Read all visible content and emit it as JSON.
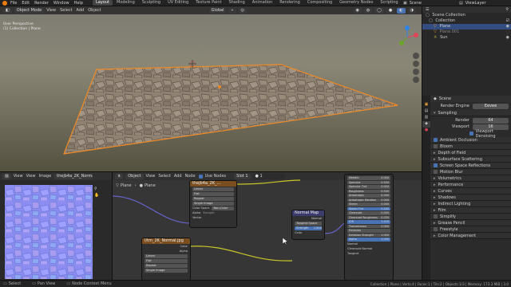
{
  "topbar": {
    "menus": [
      "File",
      "Edit",
      "Render",
      "Window",
      "Help"
    ],
    "workspaces": [
      "Layout",
      "Modeling",
      "Sculpting",
      "UV Editing",
      "Texture Paint",
      "Shading",
      "Animation",
      "Rendering",
      "Compositing",
      "Geometry Nodes",
      "Scripting"
    ],
    "active_workspace": "Layout",
    "scene": "Scene",
    "view_layer": "ViewLayer"
  },
  "viewport": {
    "mode": "Object Mode",
    "menus": [
      "View",
      "Select",
      "Add",
      "Object"
    ],
    "orientation": "Global",
    "info_line1": "User Perspective",
    "info_line2": "(1) Collection | Plane"
  },
  "outliner": {
    "root": "Scene Collection",
    "collection": "Collection",
    "items": [
      "Plane",
      "Plane.001",
      "Sun"
    ]
  },
  "properties": {
    "title": "Scene",
    "render_engine_label": "Render Engine",
    "render_engine": "Eevee",
    "sampling": "Sampling",
    "render_label": "Render",
    "render_value": "64",
    "viewport_label": "Viewport",
    "viewport_value": "16",
    "viewport_denoising": "Viewport Denoising",
    "panels": [
      "Ambient Occlusion",
      "Bloom",
      "Depth of Field",
      "Subsurface Scattering",
      "Screen Space Reflections",
      "Motion Blur",
      "Volumetrics",
      "Performance",
      "Curves",
      "Shadows",
      "Indirect Lighting",
      "Film",
      "Simplify",
      "Grease Pencil",
      "Freestyle",
      "Color Management"
    ]
  },
  "image_editor": {
    "menus": [
      "View",
      "View",
      "Image"
    ],
    "image_name": "thejb4a_2K_Normal.jpg"
  },
  "node_editor": {
    "object_label": "Object",
    "menus": [
      "View",
      "Select",
      "Add",
      "Node"
    ],
    "use_nodes": "Use Nodes",
    "slot": "Slot 1",
    "breadcrumb_object": "Plane",
    "breadcrumb_material": "Plane",
    "image_node1": {
      "title": "thejb4a_2K_...",
      "fields": [
        "Linear",
        "Flat",
        "Repeat",
        "Single Image"
      ],
      "color_space_label": "Color Space",
      "color_space": "Non-Color",
      "alpha_label": "Alpha",
      "alpha": "Straight",
      "vector": "Vector"
    },
    "normal_map": {
      "title": "Normal Map",
      "out": "Normal",
      "space": "Tangent Space",
      "strength_label": "Strength",
      "strength": "1.000",
      "color": "Color"
    },
    "image_node2": {
      "title": "I/tm_2K_Normal.jpg",
      "out1": "Color",
      "out2": "Alpha",
      "fields": [
        "Linear",
        "Flat",
        "Repeat",
        "Single Image"
      ]
    },
    "bsdf_rows": [
      [
        "Metallic",
        "0.000"
      ],
      [
        "Specular",
        "0.500"
      ],
      [
        "Specular Tint",
        "0.000"
      ],
      [
        "Roughness",
        "0.500"
      ],
      [
        "Anisotropic",
        "0.000"
      ],
      [
        "Anisotropic Rotation",
        "0.000"
      ],
      [
        "Sheen",
        "0.000"
      ],
      [
        "Sheen Tint",
        "0.500"
      ],
      [
        "Clearcoat",
        "0.000"
      ],
      [
        "Clearcoat Roughness",
        "0.030"
      ],
      [
        "IOR",
        "1.450"
      ],
      [
        "Transmission",
        "0.000"
      ],
      [
        "Emission",
        ""
      ],
      [
        "Emission Strength",
        "1.000"
      ],
      [
        "Alpha",
        "1.000"
      ]
    ],
    "bsdf_bottom": [
      "Normal",
      "Clearcoat Normal",
      "Tangent"
    ]
  },
  "status": {
    "left1": "Select",
    "left2": "Pan View",
    "left3": "Node Context Menu",
    "right": "Collection | Plane | Verts:4 | Faces:1 | Tris:2 | Objects:1/3 | Memory: 173.3 MiB | 3.0"
  }
}
